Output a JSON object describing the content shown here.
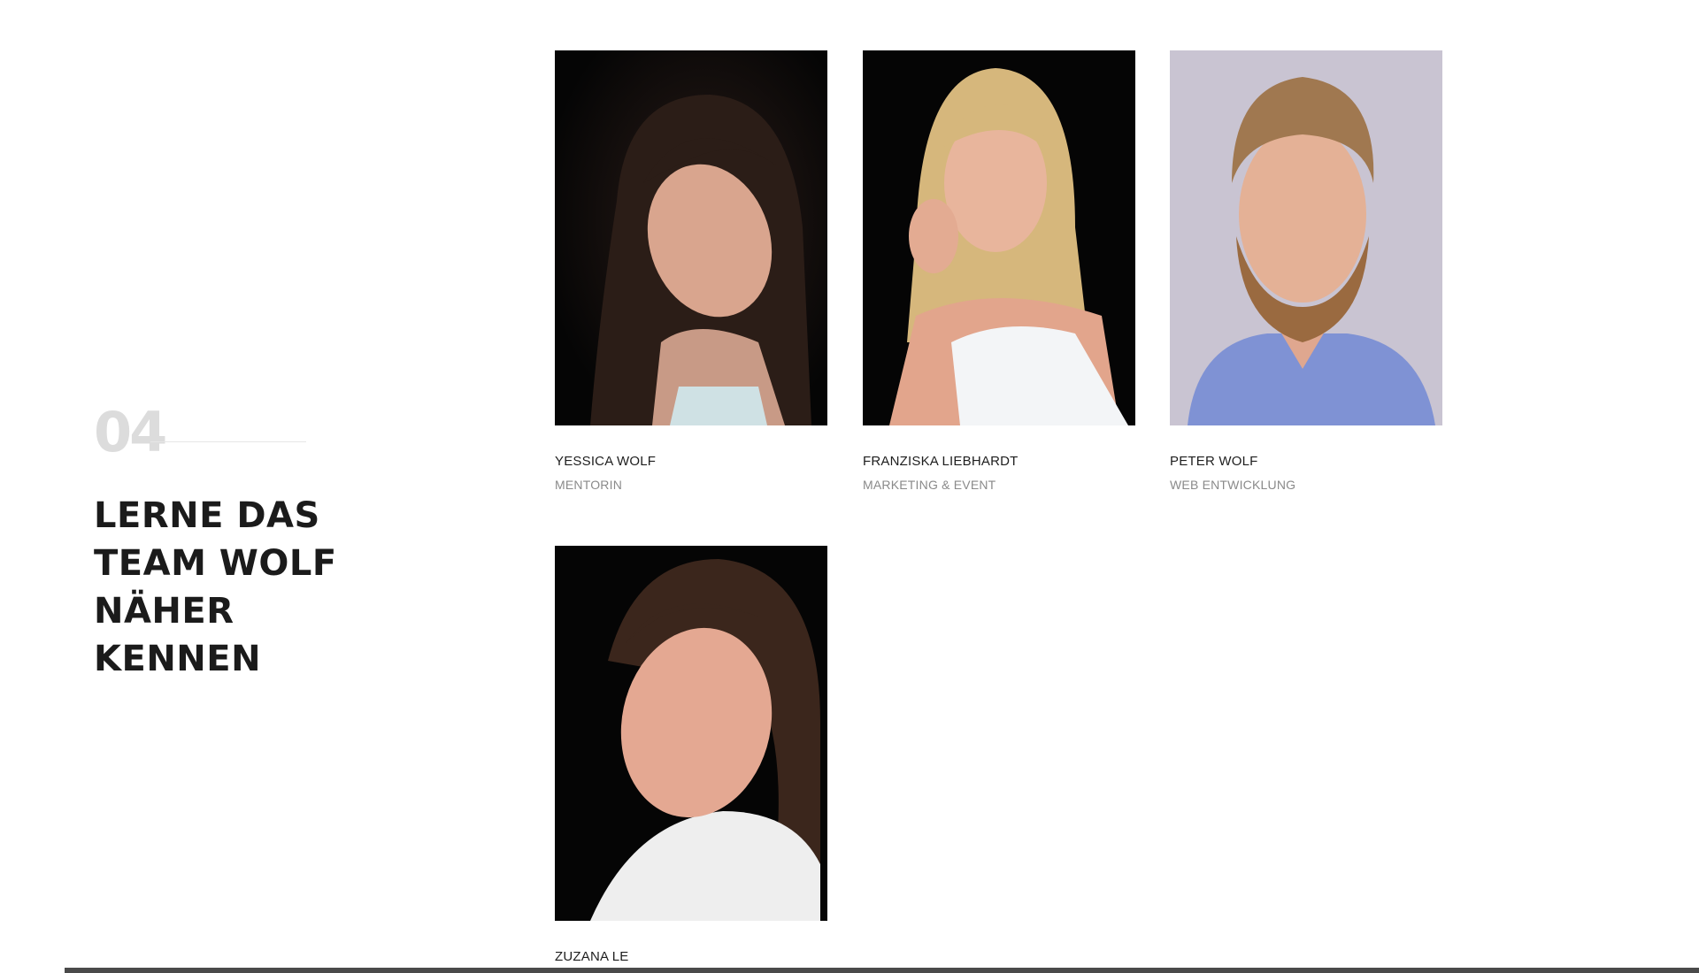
{
  "section": {
    "number": "04",
    "title_lines": [
      "LERNE DAS",
      "TEAM WOLF",
      "NÄHER",
      "KENNEN"
    ]
  },
  "team": [
    {
      "name": "YESSICA WOLF",
      "role": "MENTORIN"
    },
    {
      "name": "FRANZISKA LIEBHARDT",
      "role": "MARKETING & EVENT"
    },
    {
      "name": "PETER WOLF",
      "role": "WEB ENTWICKLUNG"
    },
    {
      "name": "ZUZANA LE",
      "role": ""
    }
  ],
  "colors": {
    "number": "#dcdcdc",
    "heading": "#1b1b1b",
    "role": "#8a8a8a",
    "bottom_bar": "#4a4a4a"
  }
}
